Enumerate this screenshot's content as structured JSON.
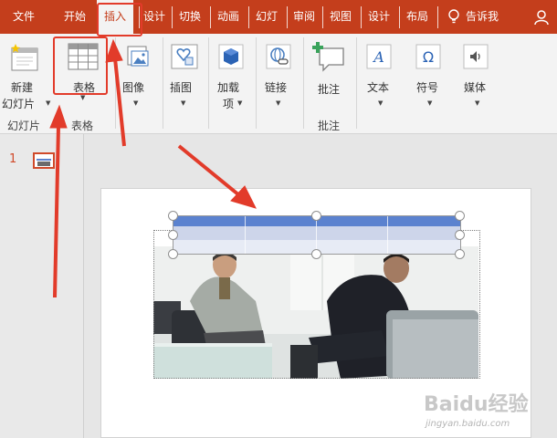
{
  "tabs": [
    {
      "label": "文件",
      "active": false
    },
    {
      "label": "开始",
      "active": false
    },
    {
      "label": "插入",
      "active": true
    },
    {
      "label": "设计",
      "active": false
    },
    {
      "label": "切换",
      "active": false
    },
    {
      "label": "动画",
      "active": false
    },
    {
      "label": "幻灯",
      "active": false
    },
    {
      "label": "审阅",
      "active": false
    },
    {
      "label": "视图",
      "active": false
    },
    {
      "label": "设计",
      "active": false
    },
    {
      "label": "布局",
      "active": false
    }
  ],
  "tell_me": "告诉我",
  "ribbon": {
    "new_slide_line1": "新建",
    "new_slide_line2": "幻灯片",
    "table": "表格",
    "images": "图像",
    "illustrations": "插图",
    "addins_line1": "加载",
    "addins_line2": "项",
    "links": "链接",
    "comment": "批注",
    "text": "文本",
    "symbols": "符号",
    "media": "媒体"
  },
  "groups": {
    "slides": "幻灯片",
    "tables": "表格",
    "comments": "批注"
  },
  "thumbnail": {
    "slide_number": "1"
  },
  "watermark": {
    "logo": "Baidu经验",
    "url": "jingyan.baidu.com"
  },
  "colors": {
    "accent": "#c43e1c",
    "table_header": "#5b82cf",
    "annotation_red": "#e23b2a"
  },
  "icons": [
    "lightbulb-icon",
    "user-icon",
    "new-slide-icon",
    "table-icon",
    "images-icon",
    "shapes-icon",
    "addins-icon",
    "link-icon",
    "comment-icon",
    "text-icon",
    "omega-icon",
    "speaker-icon"
  ]
}
